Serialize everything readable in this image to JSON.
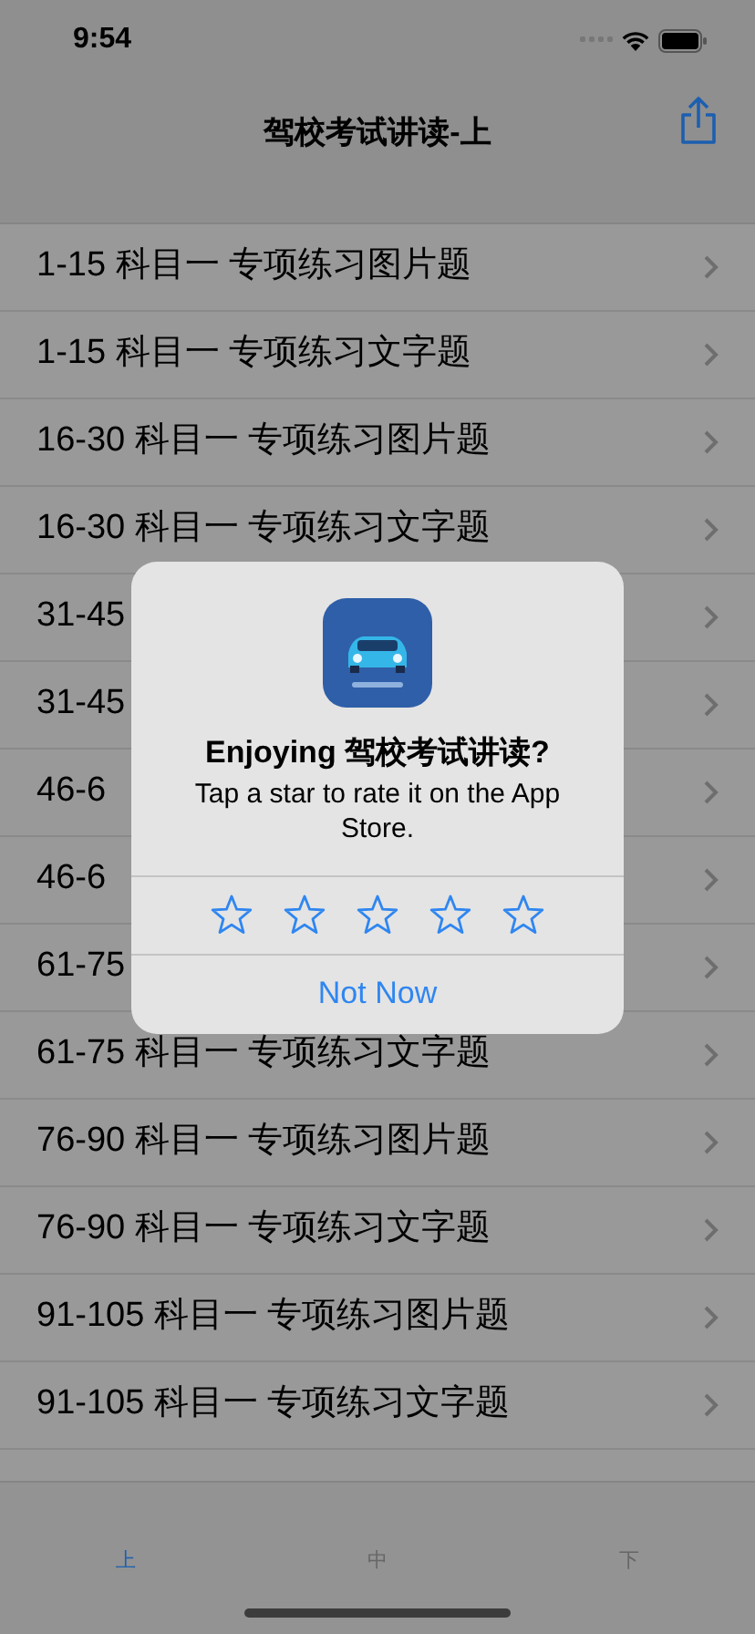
{
  "status_bar": {
    "time": "9:54"
  },
  "nav": {
    "title": "驾校考试讲读-上"
  },
  "rows": [
    {
      "label": "1-15 科目一 专项练习图片题"
    },
    {
      "label": "1-15 科目一 专项练习文字题"
    },
    {
      "label": "16-30 科目一 专项练习图片题"
    },
    {
      "label": "16-30 科目一 专项练习文字题"
    },
    {
      "label": "31-45"
    },
    {
      "label": "31-45"
    },
    {
      "label": "46-6"
    },
    {
      "label": "46-6"
    },
    {
      "label": "61-75"
    },
    {
      "label": "61-75 科目一 专项练习文字题"
    },
    {
      "label": "76-90 科目一 专项练习图片题"
    },
    {
      "label": "76-90 科目一 专项练习文字题"
    },
    {
      "label": "91-105 科目一 专项练习图片题"
    },
    {
      "label": "91-105 科目一 专项练习文字题"
    }
  ],
  "dialog": {
    "title": "Enjoying 驾校考试讲读?",
    "message": "Tap a star to rate it on the App Store.",
    "stars": 0,
    "button": "Not Now"
  },
  "tabs": [
    {
      "label": "上",
      "selected": true
    },
    {
      "label": "中",
      "selected": false
    },
    {
      "label": "下",
      "selected": false
    }
  ]
}
